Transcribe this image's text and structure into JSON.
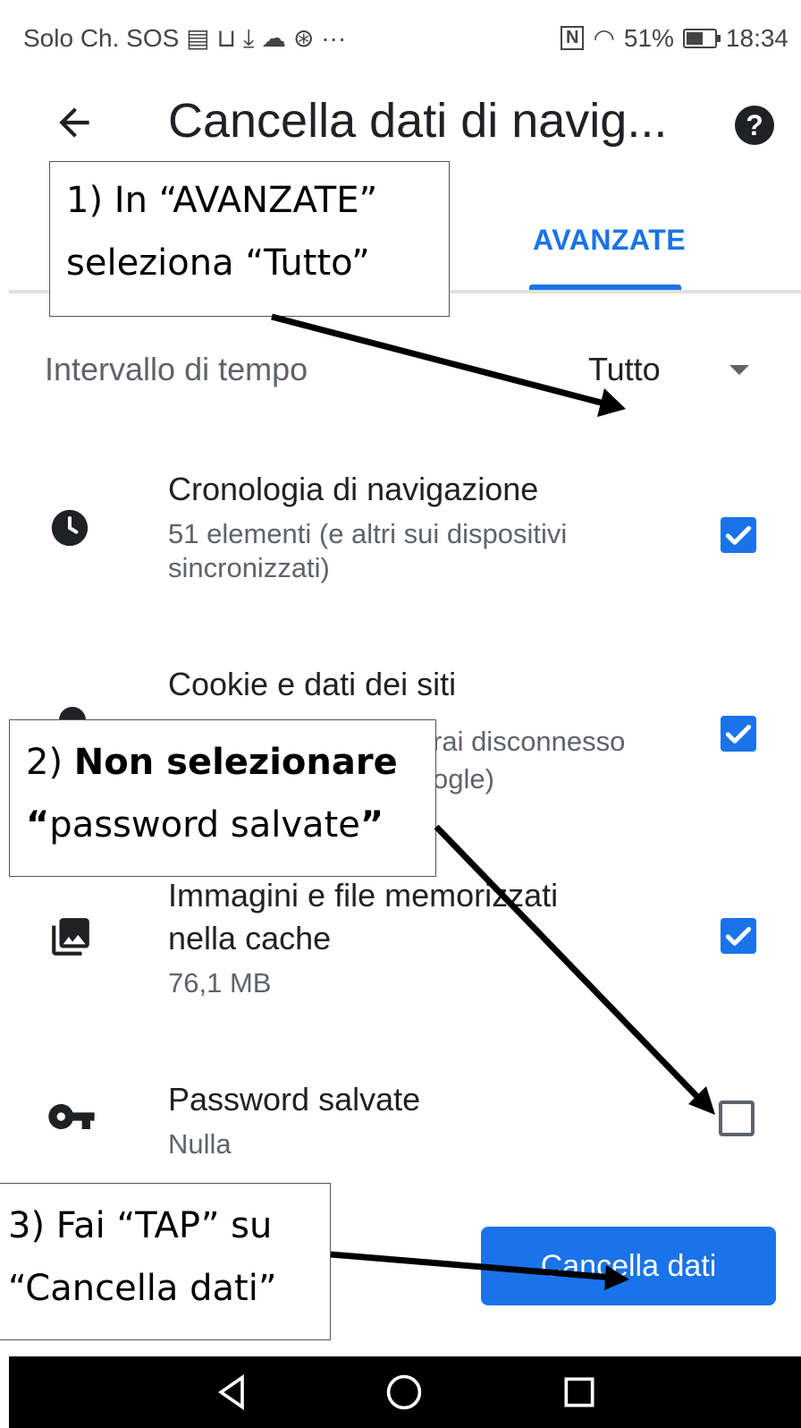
{
  "status_bar": {
    "left_text": "Solo Ch. SOS",
    "left_icons": [
      "sim-card-icon",
      "laptop-icon",
      "download-icon",
      "cloud-icon",
      "steering-icon",
      "more-icon"
    ],
    "nfc": "N",
    "battery_percent": "51%",
    "time": "18:34"
  },
  "toolbar": {
    "title": "Cancella dati di navig...",
    "help": "?"
  },
  "tabs": {
    "active_label": "AVANZATE"
  },
  "time_range": {
    "label": "Intervallo di tempo",
    "value": "Tutto"
  },
  "items": [
    {
      "icon": "clock-icon",
      "title": "Cronologia di navigazione",
      "subtitle_line1": "51 elementi (e altri sui dispositivi",
      "subtitle_line2": "sincronizzati)",
      "checked": true
    },
    {
      "icon": "cookie-icon",
      "title": "Cookie e dati dei siti",
      "subtitle_line1": "rai disconnesso",
      "subtitle_line2": "ogle)",
      "checked": true
    },
    {
      "icon": "image-stack-icon",
      "title_line1": "Immagini e file memorizzati",
      "title_line2": "nella cache",
      "subtitle": "76,1 MB",
      "checked": true
    },
    {
      "icon": "key-icon",
      "title": "Password salvate",
      "subtitle": "Nulla",
      "checked": false
    }
  ],
  "clear_button": {
    "label": "Cancella dati"
  },
  "annotations": {
    "step1_line1": "1) In “AVANZATE”",
    "step1_line2": "seleziona “Tutto”",
    "step2_prefix": "2) ",
    "step2_bold": "Non selezionare",
    "step2_quote_open": "“",
    "step2_text": "password salvate",
    "step2_quote_close": "”",
    "step3_line1": "3) Fai “TAP” su",
    "step3_line2": "“Cancella dati”"
  },
  "colors": {
    "accent": "#1a73e8",
    "text_primary": "#202124",
    "text_secondary": "#5f6368",
    "navbar": "#000000"
  }
}
